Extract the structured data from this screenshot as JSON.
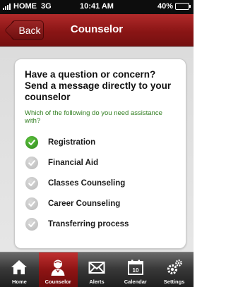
{
  "status_bar": {
    "carrier": "HOME",
    "network": "3G",
    "time": "10:41 AM",
    "battery": "40%",
    "battery_level": 0.4
  },
  "nav": {
    "back_label": "Back",
    "title": "Counselor"
  },
  "card": {
    "heading": "Have a question or concern? Send a message directly to your counselor",
    "subheading": "Which of the following do you need assistance with?",
    "options": [
      {
        "label": "Registration",
        "selected": true
      },
      {
        "label": "Financial Aid",
        "selected": false
      },
      {
        "label": "Classes Counseling",
        "selected": false
      },
      {
        "label": "Career Counseling",
        "selected": false
      },
      {
        "label": "Transferring process",
        "selected": false
      }
    ]
  },
  "tabs": [
    {
      "label": "Home",
      "icon": "home-icon",
      "active": false
    },
    {
      "label": "Counselor",
      "icon": "counselor-icon",
      "active": true
    },
    {
      "label": "Alerts",
      "icon": "envelope-icon",
      "active": false
    },
    {
      "label": "Calendar",
      "icon": "calendar-icon",
      "active": false
    },
    {
      "label": "Settings",
      "icon": "gears-icon",
      "active": false
    }
  ],
  "colors": {
    "nav_red": "#8a1515",
    "selected_green": "#2e8a1c",
    "subheading_green": "#2f7d1e",
    "tab_active": "#8e1414"
  }
}
